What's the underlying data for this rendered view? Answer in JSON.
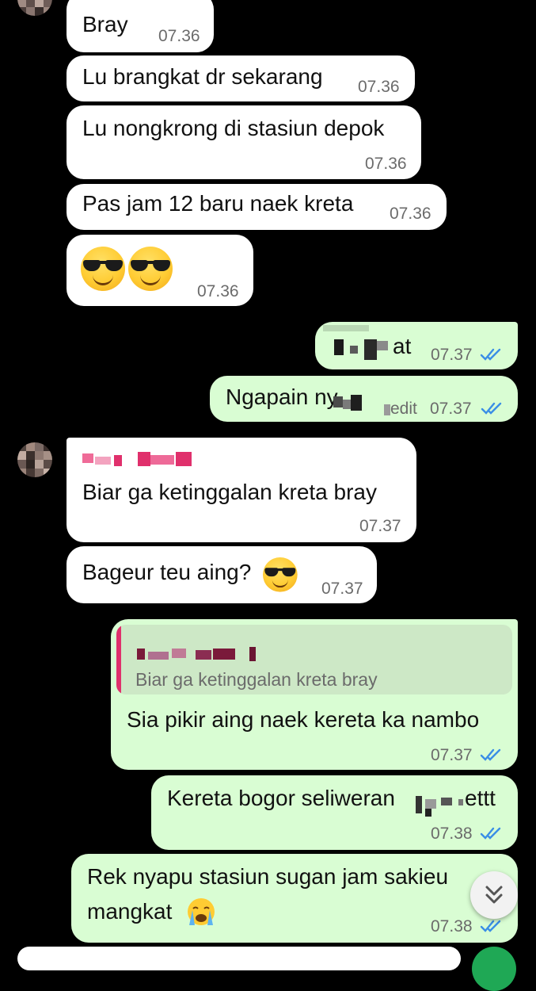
{
  "messages": [
    {
      "id": "m1",
      "text": "Bray",
      "time": "07.36"
    },
    {
      "id": "m2",
      "text": "Lu brangkat dr sekarang",
      "time": "07.36"
    },
    {
      "id": "m3",
      "text": "Lu nongkrong di stasiun depok",
      "time": "07.36"
    },
    {
      "id": "m4",
      "text": "Pas jam 12 baru naek kreta",
      "time": "07.36"
    },
    {
      "id": "m5",
      "text": "",
      "time": "07.36"
    },
    {
      "id": "m6",
      "text": "at",
      "time": "07.37"
    },
    {
      "id": "m7",
      "text": "Ngapain ny",
      "suffix": "edit",
      "time": "07.37"
    },
    {
      "id": "m8",
      "text": "Biar ga  ketinggalan kreta bray",
      "time": "07.37"
    },
    {
      "id": "m9",
      "text": "Bageur teu aing?",
      "time": "07.37"
    },
    {
      "id": "m10",
      "quote": "Biar ga  ketinggalan kreta bray",
      "text": "Sia pikir aing naek kereta ka nambo",
      "time": "07.37"
    },
    {
      "id": "m11",
      "text": "Kereta bogor seliweran",
      "suffix": "ettt",
      "time": "07.38"
    },
    {
      "id": "m12",
      "line1": "Rek nyapu stasiun sugan jam sakieu",
      "line2": "mangkat",
      "time": "07.38"
    }
  ],
  "colors": {
    "background": "#000000",
    "incoming_bubble": "#ffffff",
    "outgoing_bubble": "#d9fdd3",
    "read_ticks": "#3a8ee6",
    "sender_name": "#e0306c"
  },
  "icons": [
    "sunglasses-emoji",
    "crying-emoji",
    "read-ticks-icon",
    "scroll-down-icon"
  ]
}
